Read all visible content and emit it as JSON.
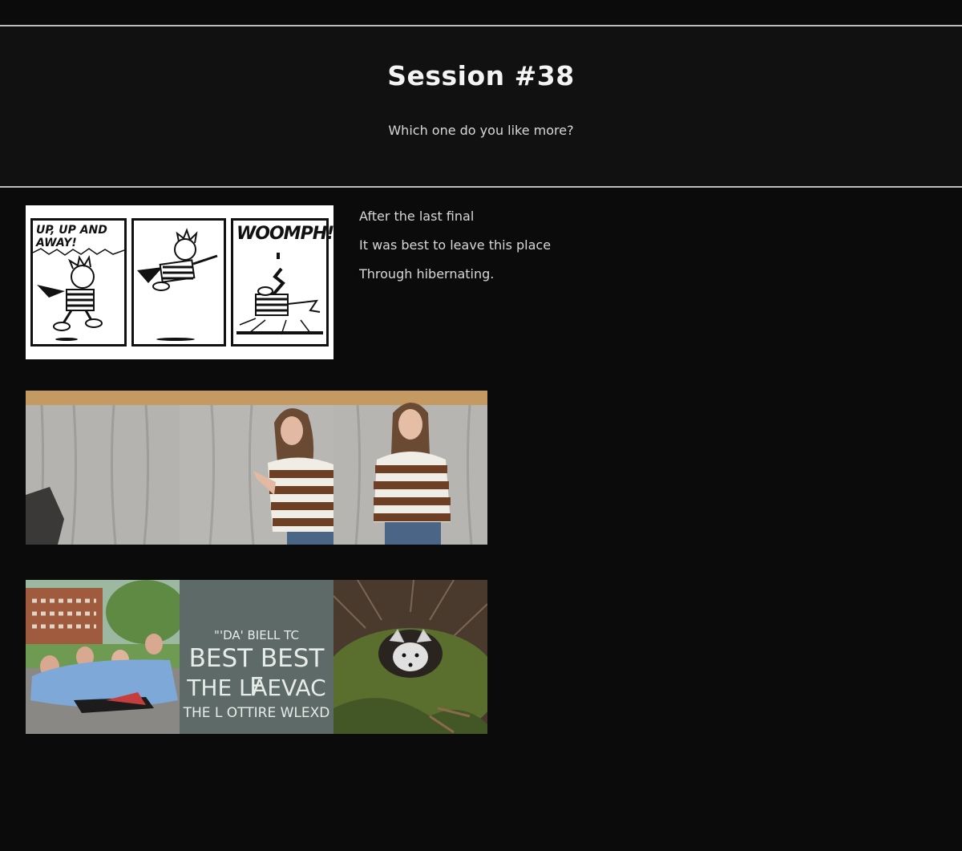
{
  "header": {
    "title": "Session #38",
    "subtitle": "Which one do you like more?"
  },
  "haiku": {
    "lines": [
      "After the last final",
      "It was best to leave this place",
      "Through hibernating."
    ]
  },
  "comic": {
    "panel1_caption": "UP, UP AND AWAY!",
    "panel3_caption": "WOOMPH!"
  },
  "sign": {
    "line1": "\"'DA' BIELL TC",
    "line2": "BEST BEST F",
    "line3": "THE LAEVAC",
    "line4": "THE L OTTIRE WLEXD"
  },
  "colors": {
    "background": "#0b0b0b",
    "header_bg": "#111111",
    "divider": "#bdbdbd"
  }
}
